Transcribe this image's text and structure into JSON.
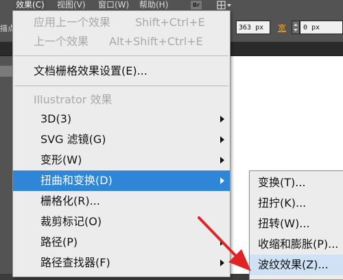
{
  "menubar": {
    "items": [
      "效果(C)",
      "视图(V)",
      "窗口(W)",
      "帮助(H)"
    ],
    "bridge_badge": "Br",
    "workspace_icon": "workspace-layout-icon"
  },
  "controlbar": {
    "cut_label": "描点",
    "x_value": "363 px",
    "width_label": "宽",
    "width_value": "0 px"
  },
  "effect_menu": {
    "apply_last": {
      "label": "应用上一个效果",
      "shortcut": "Shift+Ctrl+E"
    },
    "last_effect": {
      "label": "上一个效果",
      "shortcut": "Alt+Shift+Ctrl+E"
    },
    "doc_raster_settings": "文档栅格效果设置(E)...",
    "illustrator_header": "Illustrator 效果",
    "items": [
      {
        "label": "3D(3)",
        "has_submenu": true
      },
      {
        "label": "SVG 滤镜(G)",
        "has_submenu": true
      },
      {
        "label": "变形(W)",
        "has_submenu": true
      },
      {
        "label": "扭曲和变换(D)",
        "has_submenu": true,
        "highlighted": true
      },
      {
        "label": "栅格化(R)...",
        "has_submenu": false
      },
      {
        "label": "裁剪标记(O)",
        "has_submenu": false
      },
      {
        "label": "路径(P)",
        "has_submenu": true
      },
      {
        "label": "路径查找器(F)",
        "has_submenu": true
      }
    ]
  },
  "distort_submenu": {
    "items": [
      "变换(T)...",
      "扭拧(K)...",
      "扭转(W)...",
      "收缩和膨胀(P)...",
      "波纹效果(Z)..."
    ],
    "pointed_item": "波纹效果(Z)..."
  },
  "annotation": {
    "arrow_color": "#e02424"
  },
  "colors": {
    "highlight": "#2f86d6",
    "accent_orange": "#e8a33a"
  }
}
